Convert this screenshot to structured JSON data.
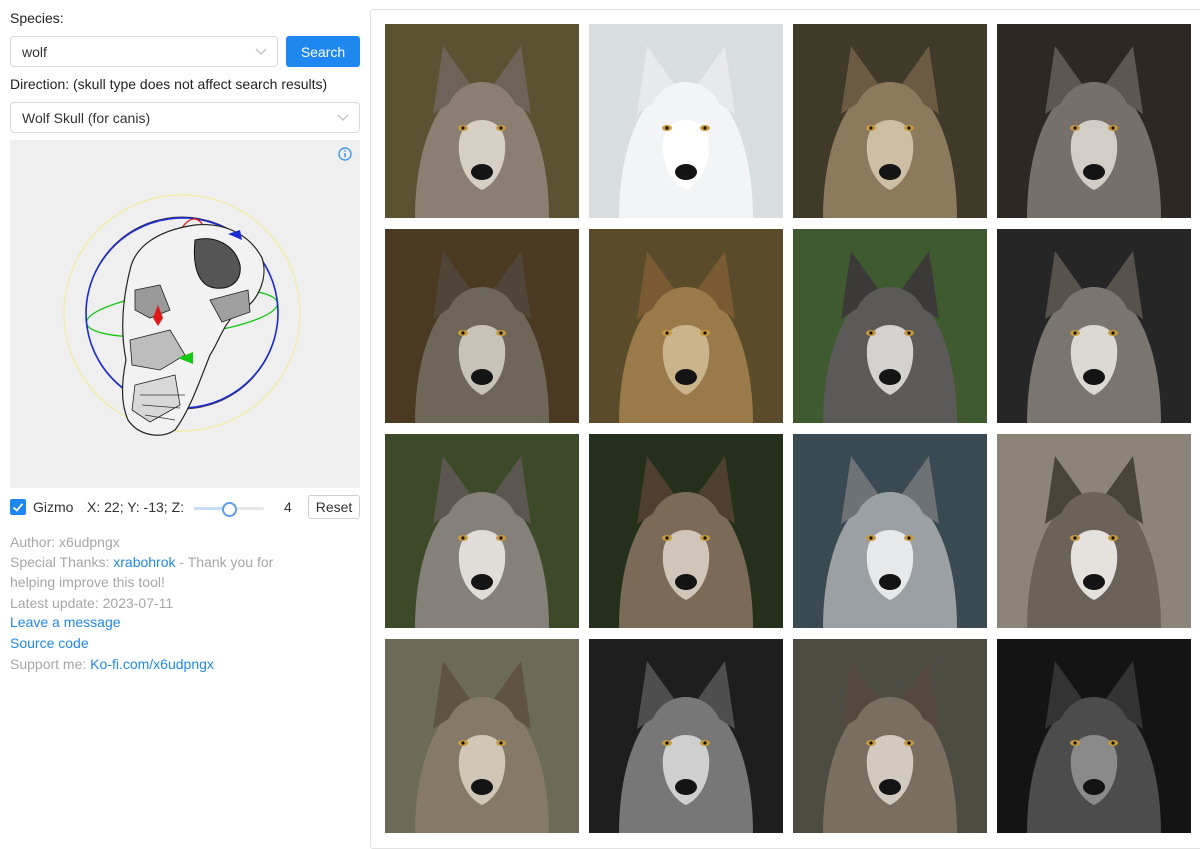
{
  "form": {
    "species_label": "Species:",
    "species_value": "wolf",
    "search_button": "Search",
    "direction_label": "Direction: (skull type does not affect search results)",
    "skull_value": "Wolf Skull (for canis)"
  },
  "viewer": {
    "gizmo_label": "Gizmo",
    "gizmo_checked": true,
    "rotation_text": "X: 22; Y: -13; Z:",
    "zoom_value": "4",
    "zoom_slider_level": 0.5,
    "reset_button": "Reset"
  },
  "info": {
    "author": "Author: x6udpngx",
    "thanks_prefix": "Special Thanks: ",
    "thanks_name": "xrabohrok",
    "thanks_suffix": " - Thank you for helping improve this tool!",
    "latest_update": "Latest update: 2023-07-11",
    "leave_message": "Leave a message",
    "source_code": "Source code",
    "support_prefix": "Support me: ",
    "support_link": "Ko-fi.com/x6udpngx"
  },
  "colors": {
    "accent": "#1e88f0",
    "gizmo_blue": "#1a2bd6",
    "gizmo_red": "#e01818",
    "gizmo_green": "#14c814",
    "gizmo_yellow": "#f0ee9a"
  },
  "results": [
    {
      "bg": "#5b5232",
      "fur": "#8a7f72",
      "face": "#d6cfc4",
      "ear": "#6e6358"
    },
    {
      "bg": "#d8dde0",
      "fur": "#f2f4f5",
      "face": "#ffffff",
      "ear": "#e7e9ea"
    },
    {
      "bg": "#3f3a2a",
      "fur": "#8c7a5c",
      "face": "#cdbfa3",
      "ear": "#6b5b42"
    },
    {
      "bg": "#2e2824",
      "fur": "#77706a",
      "face": "#d2cdc7",
      "ear": "#5e5650"
    },
    {
      "bg": "#4a3a22",
      "fur": "#6e6659",
      "face": "#c9c2b6",
      "ear": "#4f4639"
    },
    {
      "bg": "#5a4c2a",
      "fur": "#9a7a48",
      "face": "#cbb38b",
      "ear": "#7a5a32"
    },
    {
      "bg": "#3f5a2e",
      "fur": "#5c5a58",
      "face": "#d4d2cf",
      "ear": "#3c3a38"
    },
    {
      "bg": "#262626",
      "fur": "#7a756e",
      "face": "#dcd8d2",
      "ear": "#57524c"
    },
    {
      "bg": "#3c4a2a",
      "fur": "#85807a",
      "face": "#e0ddd8",
      "ear": "#5c5650"
    },
    {
      "bg": "#24301c",
      "fur": "#7b6a58",
      "face": "#cfc5b8",
      "ear": "#4e3f30"
    },
    {
      "bg": "#3a4a52",
      "fur": "#9aa0a3",
      "face": "#e6e8e9",
      "ear": "#6c7275"
    },
    {
      "bg": "#8c8478",
      "fur": "#6b635a",
      "face": "#e5e2dd",
      "ear": "#4a433c"
    },
    {
      "bg": "#6e6a58",
      "fur": "#857a68",
      "face": "#cfc6b6",
      "ear": "#5f5444"
    },
    {
      "bg": "#1e1e1e",
      "fur": "#777777",
      "face": "#cfcfcf",
      "ear": "#4e4e4e"
    },
    {
      "bg": "#4d4c42",
      "fur": "#7a6e60",
      "face": "#d2cabe",
      "ear": "#54493c"
    },
    {
      "bg": "#141414",
      "fur": "#4c4c4c",
      "face": "#8a8a8a",
      "ear": "#333333"
    }
  ]
}
